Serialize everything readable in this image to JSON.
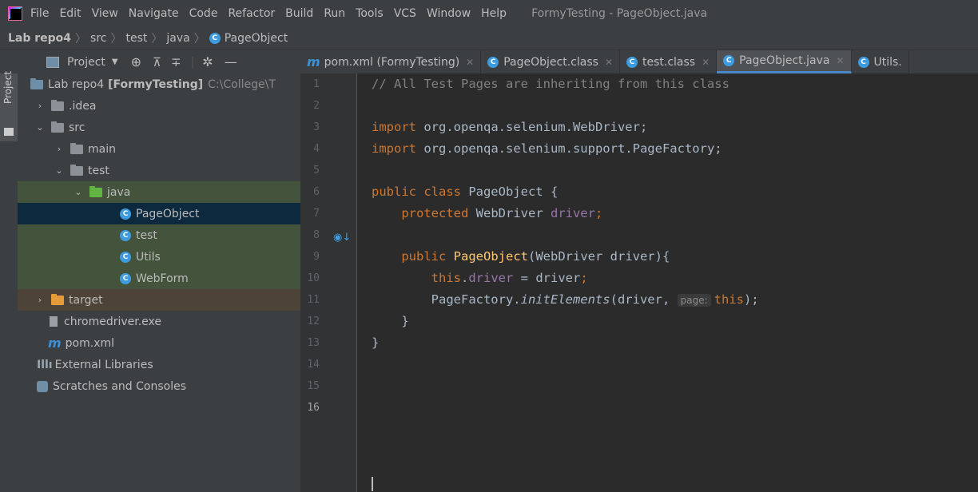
{
  "menubar": {
    "items": [
      "File",
      "Edit",
      "View",
      "Navigate",
      "Code",
      "Refactor",
      "Build",
      "Run",
      "Tools",
      "VCS",
      "Window",
      "Help"
    ],
    "window_title": "FormyTesting - PageObject.java"
  },
  "breadcrumb": [
    "Lab repo4",
    "src",
    "test",
    "java",
    "PageObject"
  ],
  "project_panel": {
    "tab_label": "Project",
    "header_label": "Project",
    "tree": [
      {
        "label": "Lab repo4",
        "bold_suffix": "[FormyTesting]",
        "path": "C:\\College\\T"
      },
      {
        "label": ".idea"
      },
      {
        "label": "src"
      },
      {
        "label": "main"
      },
      {
        "label": "test"
      },
      {
        "label": "java"
      },
      {
        "label": "PageObject"
      },
      {
        "label": "test"
      },
      {
        "label": "Utils"
      },
      {
        "label": "WebForm"
      },
      {
        "label": "target"
      },
      {
        "label": "chromedriver.exe"
      },
      {
        "label": "pom.xml"
      },
      {
        "label": "External Libraries"
      },
      {
        "label": "Scratches and Consoles"
      }
    ]
  },
  "tabs": [
    {
      "label": "pom.xml (FormyTesting)",
      "icon": "maven-icon"
    },
    {
      "label": "PageObject.class",
      "icon": "class-icon"
    },
    {
      "label": "test.class",
      "icon": "class-icon"
    },
    {
      "label": "PageObject.java",
      "icon": "class-icon",
      "active": true
    },
    {
      "label": "Utils.",
      "icon": "class-icon"
    }
  ],
  "editor": {
    "line_numbers": [
      "1",
      "2",
      "3",
      "4",
      "5",
      "6",
      "7",
      "8",
      "9",
      "10",
      "11",
      "12",
      "13",
      "14",
      "15",
      "16"
    ],
    "code": {
      "l1": "// All Test Pages are inheriting from this class",
      "l3_kw": "import",
      "l3_rest": " org.openqa.selenium.WebDriver;",
      "l4_kw": "import",
      "l4_rest": " org.openqa.selenium.support.PageFactory;",
      "l6_kw": "public class",
      "l6_rest": " PageObject {",
      "l7_kw": "protected",
      "l7_type": " WebDriver ",
      "l7_field": "driver",
      "l7_end": ";",
      "l9_kw": "public",
      "l9_method": "PageObject",
      "l9_rest": "(WebDriver driver){",
      "l10_kw": "this",
      "l10_dot": ".",
      "l10_field": "driver",
      "l10_rest": " = driver",
      "l10_end": ";",
      "l11_cls": "PageFactory.",
      "l11_static": "initElements",
      "l11_args": "(driver, ",
      "l11_hint": "page:",
      "l11_this": "this",
      "l11_end": ");",
      "l12": "}",
      "l13": "}"
    }
  },
  "colors": {
    "accent": "#4a88c7",
    "keyword": "#cc7832",
    "field": "#9876aa",
    "method": "#ffc66d",
    "comment": "#808080"
  }
}
